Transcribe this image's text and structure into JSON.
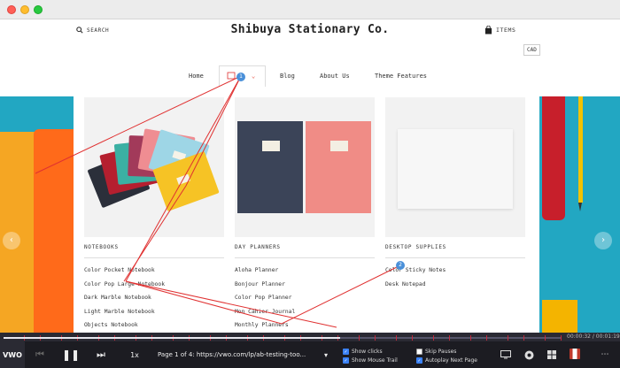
{
  "window": {
    "buttons": [
      "close",
      "minimize",
      "maximize"
    ]
  },
  "header": {
    "search_label": "SEARCH",
    "brand": "Shibuya Stationary Co.",
    "cart_label": "ITEMS",
    "currency": "CAD"
  },
  "nav": {
    "items": [
      "Home",
      "Blog",
      "About Us",
      "Theme Features"
    ],
    "active_chevron": "⌄"
  },
  "mega_menu": {
    "columns": [
      {
        "heading": "NOTEBOOKS",
        "items": [
          "Color Pocket Notebook",
          "Color Pop Large Notebook",
          "Dark Marble Notebook",
          "Light Marble Notebook",
          "Objects Notebook"
        ]
      },
      {
        "heading": "DAY PLANNERS",
        "items": [
          "Aloha Planner",
          "Bonjour Planner",
          "Color Pop Planner",
          "Mon Cahier Journal",
          "Monthly Planners"
        ]
      },
      {
        "heading": "DESKTOP SUPPLIES",
        "items": [
          "Color Sticky Notes",
          "Desk Notepad"
        ]
      }
    ]
  },
  "hero": {
    "prev_arrow": "‹",
    "next_arrow": "›"
  },
  "trail": {
    "badge_1": "1",
    "badge_2": "2",
    "color": "#e03131"
  },
  "player": {
    "logo": "VWO",
    "prev": "⏮",
    "pause": "❚❚",
    "next": "⏭",
    "speed": "1x",
    "page_info": "Page 1 of 4: https://vwo.com/lp/ab-testing-too...",
    "dropdown": "▾",
    "time": "00:00:32 / 00:01:19",
    "options": [
      {
        "label": "Show clicks",
        "checked": true
      },
      {
        "label": "Show Mouse Trail",
        "checked": true
      },
      {
        "label": "Skip Pauses",
        "checked": false
      },
      {
        "label": "Autoplay Next Page",
        "checked": true
      }
    ],
    "device_icons": [
      "desktop-icon",
      "chrome-icon",
      "windows-icon",
      "flag-icon",
      "more-icon"
    ],
    "more": "⋯"
  }
}
